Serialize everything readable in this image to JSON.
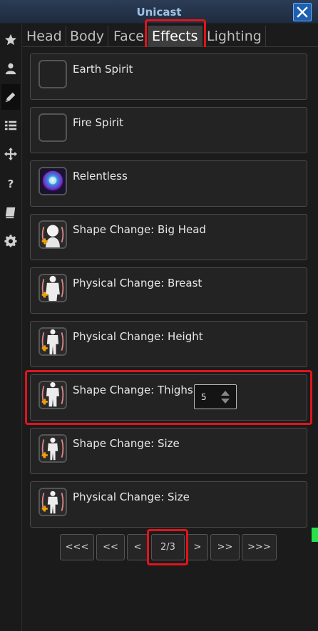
{
  "window": {
    "title": "Unicast",
    "close_icon": "close-icon",
    "accent": "#1d5fb0"
  },
  "sidebar": {
    "items": [
      {
        "icon": "star-icon"
      },
      {
        "icon": "user-icon"
      },
      {
        "icon": "pencil-icon",
        "active": true
      },
      {
        "icon": "list-icon"
      },
      {
        "icon": "move-icon"
      },
      {
        "icon": "help-icon",
        "glyph": "?"
      },
      {
        "icon": "book-icon"
      },
      {
        "icon": "gear-icon"
      }
    ]
  },
  "tabs": [
    {
      "label": "Head"
    },
    {
      "label": "Body"
    },
    {
      "label": "Face"
    },
    {
      "label": "Effects",
      "active": true
    },
    {
      "label": "Lighting"
    }
  ],
  "effects": [
    {
      "label": "Earth Spirit",
      "icon": "empty-slot-icon"
    },
    {
      "label": "Fire Spirit",
      "icon": "empty-slot-icon"
    },
    {
      "label": "Relentless",
      "icon": "relentless-orb-icon"
    },
    {
      "label": "Shape Change: Big Head",
      "icon": "big-head-icon"
    },
    {
      "label": "Physical Change: Breast",
      "icon": "breast-icon"
    },
    {
      "label": "Physical Change: Height",
      "icon": "height-icon"
    },
    {
      "label": "Shape Change: Thighs",
      "icon": "thighs-icon",
      "stepper_value": "5"
    },
    {
      "label": "Shape Change: Size",
      "icon": "size-icon"
    },
    {
      "label": "Physical Change: Size",
      "icon": "physical-size-icon"
    }
  ],
  "pager": {
    "first": "<<<",
    "prev_block": "<<",
    "prev": "<",
    "page": "2/3",
    "next": ">",
    "next_block": ">>",
    "last": ">>>"
  },
  "colors": {
    "highlight": "#e0141b",
    "panel": "#232323",
    "tab_active": "#3d3d3d"
  }
}
